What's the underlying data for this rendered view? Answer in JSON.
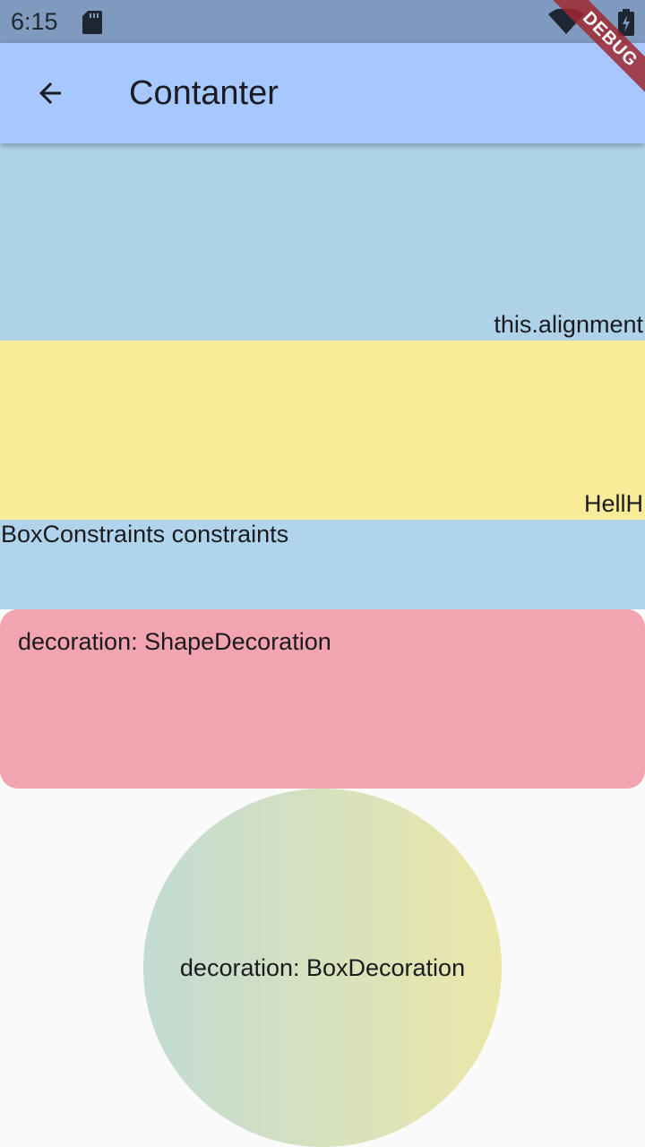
{
  "status_bar": {
    "time": "6:15",
    "icons": [
      "sd-card-icon",
      "wifi-icon",
      "battery-icon"
    ],
    "background": "#7f9abe"
  },
  "app_bar": {
    "title": "Contanter",
    "back_icon": "arrow-back-icon",
    "background": "#a6c8ff"
  },
  "boxes": {
    "alignment": {
      "text": "this.alignment",
      "color": "#aed2e8"
    },
    "hell": {
      "text": "HellH",
      "color": "#f9ec98"
    },
    "constraints": {
      "text": "BoxConstraints constraints",
      "color": "#b0d4ec"
    },
    "shape": {
      "text": "decoration: ShapeDecoration",
      "color": "#f2a4b0"
    },
    "circle": {
      "text": "decoration: BoxDecoration",
      "gradient": [
        "#c2dbd4",
        "#ebe7a8"
      ]
    }
  },
  "debug_banner": {
    "text": "DEBUG",
    "color": "#a02832"
  }
}
